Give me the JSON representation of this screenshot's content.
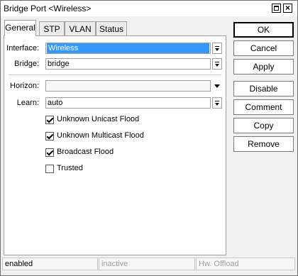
{
  "window": {
    "title": "Bridge Port <Wireless>"
  },
  "tabs": [
    {
      "label": "General"
    },
    {
      "label": "STP"
    },
    {
      "label": "VLAN"
    },
    {
      "label": "Status"
    }
  ],
  "form": {
    "interface": {
      "label": "Interface:",
      "value": "Wireless"
    },
    "bridge": {
      "label": "Bridge:",
      "value": "bridge"
    },
    "horizon": {
      "label": "Horizon:",
      "value": ""
    },
    "learn": {
      "label": "Learn:",
      "value": "auto"
    },
    "checkboxes": [
      {
        "label": "Unknown Unicast Flood",
        "checked": true
      },
      {
        "label": "Unknown Multicast Flood",
        "checked": true
      },
      {
        "label": "Broadcast Flood",
        "checked": true
      },
      {
        "label": "Trusted",
        "checked": false
      }
    ]
  },
  "buttons": {
    "ok": "OK",
    "cancel": "Cancel",
    "apply": "Apply",
    "disable": "Disable",
    "comment": "Comment",
    "copy": "Copy",
    "remove": "Remove"
  },
  "status": {
    "state": "enabled",
    "activity": "inactive",
    "offload": "Hw. Offload"
  }
}
